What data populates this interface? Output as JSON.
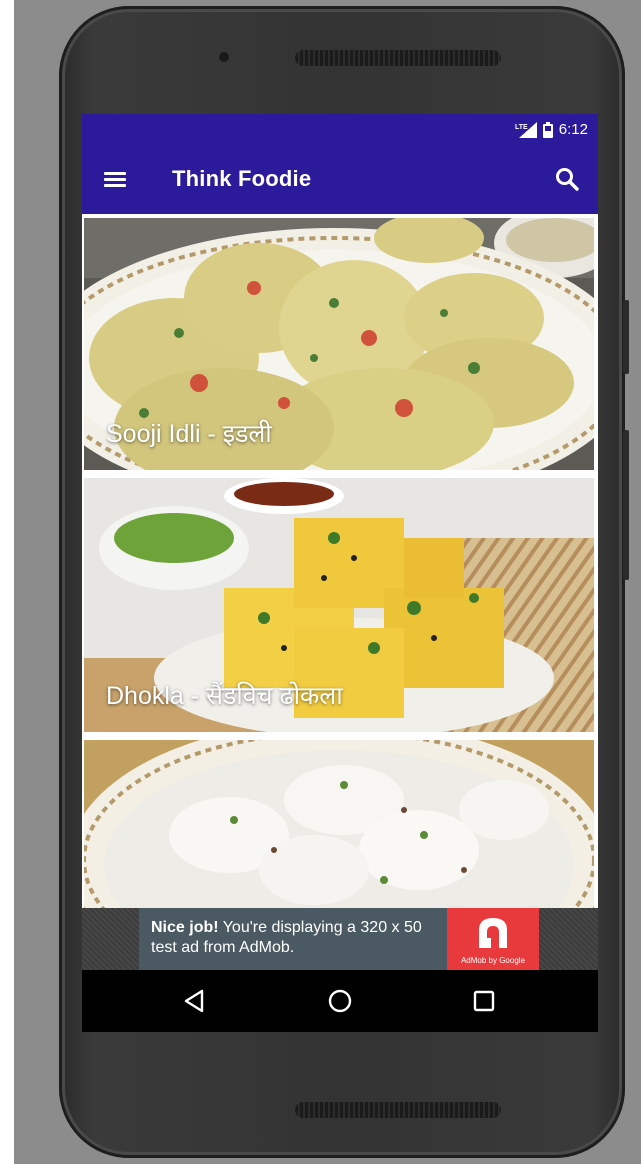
{
  "status_bar": {
    "time": "6:12",
    "network": "LTE"
  },
  "app_bar": {
    "title": "Think Foodie"
  },
  "recipes": [
    {
      "label": "Sooji Idli -  इडली"
    },
    {
      "label": "Dhokla - सैंडविच ढोकला"
    },
    {
      "label": ""
    }
  ],
  "ad": {
    "bold": "Nice job!",
    "text": " You're displaying a 320 x 50 test ad from AdMob.",
    "brand": "AdMob by Google"
  },
  "colors": {
    "primary": "#2b1a99",
    "ad_background": "#4b5a62",
    "ad_logo": "#e8393c"
  },
  "icons": {
    "menu": "hamburger-menu-icon",
    "search": "search-icon",
    "back": "back-triangle-icon",
    "home": "home-circle-icon",
    "recents": "recents-square-icon"
  }
}
